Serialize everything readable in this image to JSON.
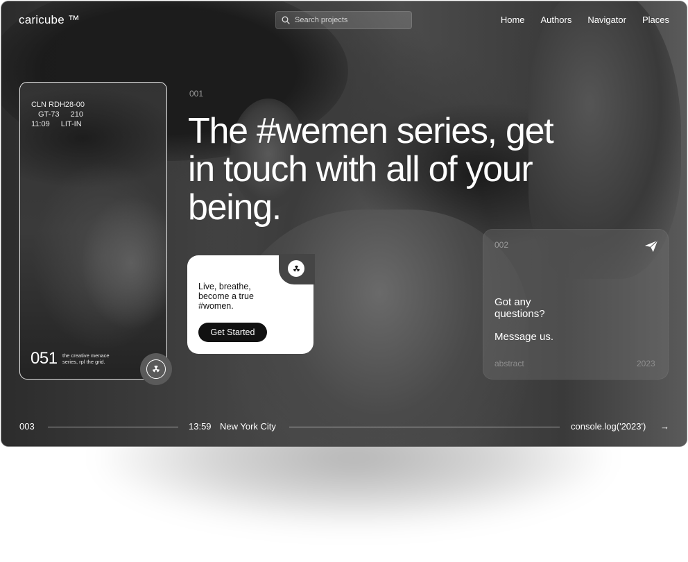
{
  "brand": {
    "logo": "caricube ™"
  },
  "search": {
    "placeholder": "Search projects"
  },
  "nav": {
    "items": [
      "Home",
      "Authors",
      "Navigator",
      "Places"
    ]
  },
  "phone_card": {
    "code": "CLN RDH28-00",
    "meta_row1": [
      "GT-73",
      "210"
    ],
    "meta_row2": [
      "11:09",
      "LIT-IN"
    ],
    "number": "051",
    "caption": "the creative menace series, rpl the grid."
  },
  "hero": {
    "index": "001",
    "headline": "The #wemen series, get in touch with all of your being."
  },
  "cta": {
    "text": "Live, breathe, become a true #women.",
    "button": "Get Started"
  },
  "question_card": {
    "index": "002",
    "title": "Got any questions?",
    "message": "Message us.",
    "tag": "abstract",
    "year": "2023"
  },
  "footer": {
    "index": "003",
    "time": "13:59",
    "city": "New York City",
    "code": "console.log('2023')",
    "arrow": "→"
  },
  "icons": {
    "search": "search-icon",
    "send": "paper-plane-icon",
    "badge": "radiation-icon",
    "next": "arrow-right-icon"
  }
}
